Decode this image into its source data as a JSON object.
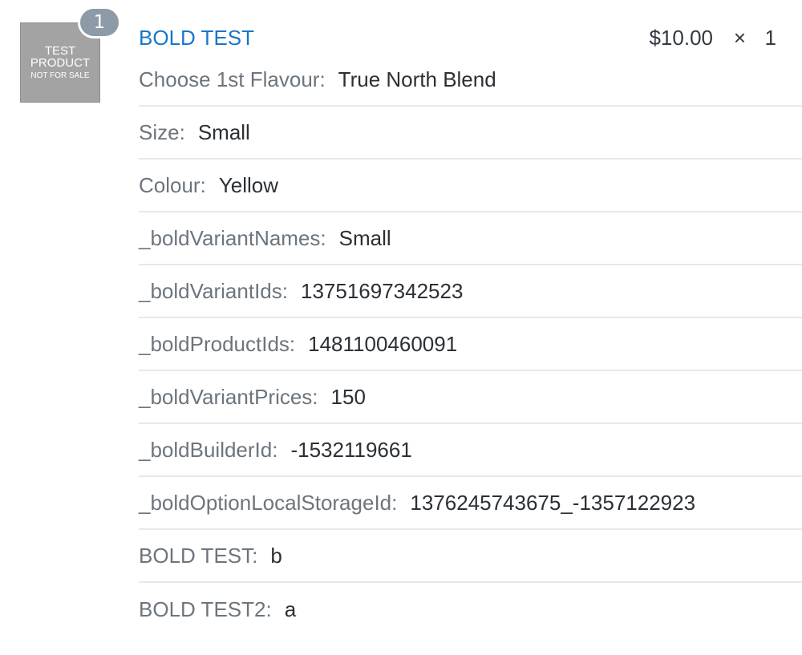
{
  "item": {
    "thumbnail": {
      "line1": "TEST",
      "line2": "PRODUCT",
      "line3": "NOT FOR SALE"
    },
    "quantity_badge": "1",
    "title": "BOLD TEST",
    "price": "$10.00",
    "times": "×",
    "quantity": "1",
    "properties": [
      {
        "key": "Choose 1st Flavour:",
        "value": "True North Blend"
      },
      {
        "key": "Size:",
        "value": "Small"
      },
      {
        "key": "Colour:",
        "value": "Yellow"
      },
      {
        "key": "_boldVariantNames:",
        "value": "Small"
      },
      {
        "key": "_boldVariantIds:",
        "value": "13751697342523"
      },
      {
        "key": "_boldProductIds:",
        "value": "1481100460091"
      },
      {
        "key": "_boldVariantPrices:",
        "value": "150"
      },
      {
        "key": "_boldBuilderId:",
        "value": "-1532119661"
      },
      {
        "key": "_boldOptionLocalStorageId:",
        "value": "1376245743675_-1357122923"
      },
      {
        "key": "BOLD TEST:",
        "value": "b"
      },
      {
        "key": "BOLD TEST2:",
        "value": "a"
      }
    ]
  },
  "colors": {
    "title_link": "#1a76c9",
    "badge_bg": "#8d9aa7",
    "thumbnail_bg": "#a3a3a3"
  }
}
